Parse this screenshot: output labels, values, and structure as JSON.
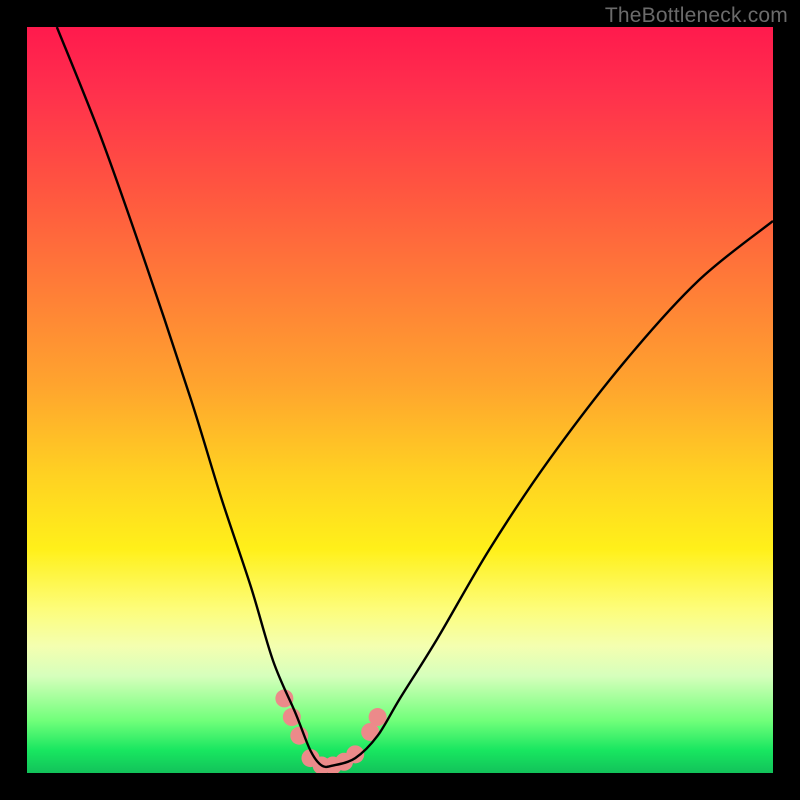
{
  "watermark": {
    "text": "TheBottleneck.com"
  },
  "colors": {
    "frame": "#000000",
    "curve_stroke": "#000000",
    "marker_fill": "#ec8a8a",
    "marker_stroke": "#d97474",
    "gradient_top": "#ff1a4d",
    "gradient_bottom": "#12c25a"
  },
  "chart_data": {
    "type": "line",
    "title": "",
    "xlabel": "",
    "ylabel": "",
    "xlim": [
      0,
      100
    ],
    "ylim": [
      0,
      100
    ],
    "grid": false,
    "series": [
      {
        "name": "bottleneck-curve",
        "x": [
          4,
          10,
          16,
          22,
          26,
          30,
          33,
          36,
          38,
          39.5,
          41,
          44,
          47,
          50,
          55,
          62,
          70,
          80,
          90,
          100
        ],
        "values": [
          100,
          85,
          68,
          50,
          37,
          25,
          15,
          8,
          3,
          1,
          1,
          2,
          5,
          10,
          18,
          30,
          42,
          55,
          66,
          74
        ]
      }
    ],
    "markers": [
      {
        "x": 34.5,
        "y": 10
      },
      {
        "x": 35.5,
        "y": 7.5
      },
      {
        "x": 36.5,
        "y": 5
      },
      {
        "x": 38.0,
        "y": 2
      },
      {
        "x": 39.5,
        "y": 1
      },
      {
        "x": 41.0,
        "y": 1
      },
      {
        "x": 42.5,
        "y": 1.5
      },
      {
        "x": 44.0,
        "y": 2.5
      },
      {
        "x": 46.0,
        "y": 5.5
      },
      {
        "x": 47.0,
        "y": 7.5
      }
    ]
  }
}
